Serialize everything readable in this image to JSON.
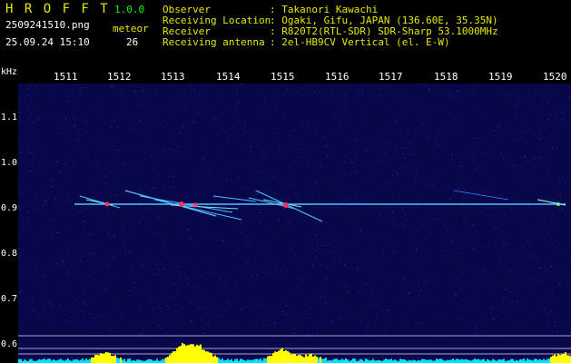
{
  "header": {
    "app_name": "H R O F F T",
    "version": "1.0.0",
    "filename": "2509241510.png",
    "datetime": "25.09.24 15:10",
    "meteor_label": "meteor",
    "meteor_count": "26",
    "info": [
      {
        "key": "Observer",
        "value": ": Takanori Kawachi"
      },
      {
        "key": "Receiving Location",
        "value": ": Ogaki, Gifu, JAPAN (136.60E, 35.35N)"
      },
      {
        "key": "Receiver",
        "value": ": R820T2(RTL-SDR) SDR-Sharp 53.1000MHz"
      },
      {
        "key": "Receiving antenna",
        "value": ": 2el-HB9CV Vertical (el. E-W)"
      }
    ]
  },
  "spectrogram": {
    "y_unit": "kHz",
    "y_ticks": [
      "1.1",
      "1.0",
      "0.9",
      "0.8",
      "0.7",
      "0.6"
    ],
    "x_ticks": [
      "1511",
      "1512",
      "1513",
      "1514",
      "1515",
      "1516",
      "1517",
      "1518",
      "1519",
      "1520"
    ],
    "colors": {
      "background": "#07074a",
      "noise": "#1a2ad8",
      "trace": "#4fc4ff",
      "hot": "#ff3060",
      "level_cyan": "#00e0ff",
      "level_yellow": "#ffff00",
      "header_yellow": "#e8e800",
      "header_green": "#00ff00"
    }
  }
}
